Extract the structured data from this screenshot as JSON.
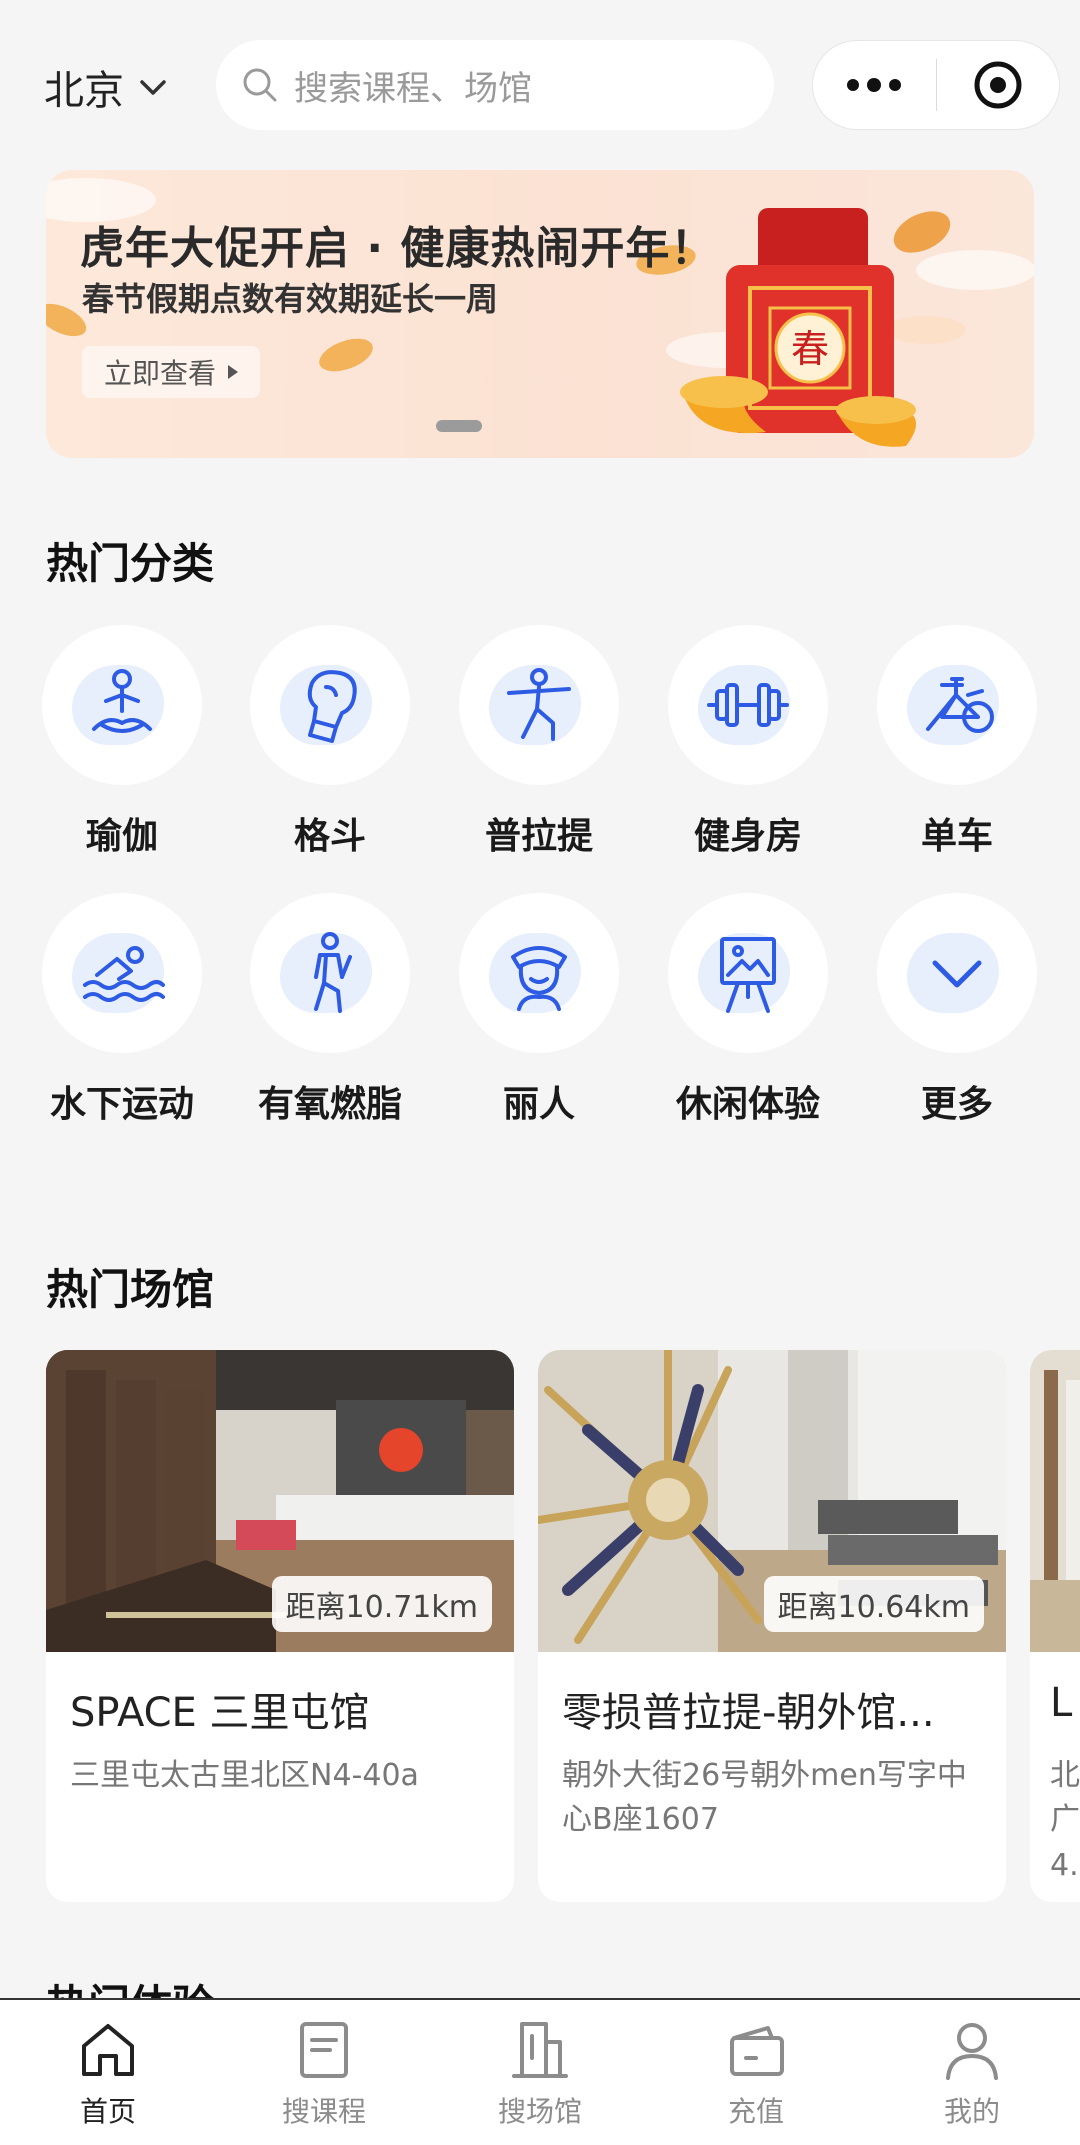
{
  "header": {
    "city": "北京",
    "search_placeholder": "搜索课程、场馆"
  },
  "banner": {
    "title": "虎年大促开启 · 健康热闹开年！",
    "subtitle": "春节假期点数有效期延长一周",
    "cta": "立即查看",
    "badge_char": "春"
  },
  "categories": {
    "title": "热门分类",
    "items": [
      {
        "label": "瑜伽",
        "icon": "meditation-icon"
      },
      {
        "label": "格斗",
        "icon": "boxing-glove-icon"
      },
      {
        "label": "普拉提",
        "icon": "stretch-pose-icon"
      },
      {
        "label": "健身房",
        "icon": "dumbbell-icon"
      },
      {
        "label": "单车",
        "icon": "bicycle-icon"
      },
      {
        "label": "水下运动",
        "icon": "swimming-icon"
      },
      {
        "label": "有氧燃脂",
        "icon": "running-icon"
      },
      {
        "label": "丽人",
        "icon": "beauty-icon"
      },
      {
        "label": "休闲体验",
        "icon": "easel-icon"
      },
      {
        "label": "更多",
        "icon": "chevron-down-icon"
      }
    ]
  },
  "venues": {
    "title": "热门场馆",
    "items": [
      {
        "name": "SPACE 三里屯馆",
        "address": "三里屯太古里北区N4-40a",
        "distance": "距离10.71km"
      },
      {
        "name": "零损普拉提-朝外馆...",
        "address": "朝外大街26号朝外men写字中心B座1607",
        "distance": "距离10.64km"
      },
      {
        "name": "L",
        "address": "北广",
        "distance": "",
        "extra": "4."
      }
    ]
  },
  "next_section": {
    "title": "热门体验"
  },
  "tabs": [
    {
      "label": "首页",
      "icon": "home-icon",
      "active": true
    },
    {
      "label": "搜课程",
      "icon": "course-icon",
      "active": false
    },
    {
      "label": "搜场馆",
      "icon": "building-icon",
      "active": false
    },
    {
      "label": "充值",
      "icon": "wallet-icon",
      "active": false
    },
    {
      "label": "我的",
      "icon": "user-icon",
      "active": false
    }
  ],
  "colors": {
    "accent_blue": "#2d5be3",
    "banner_bg": "#fbe2d3",
    "red_packet": "#e0312b"
  }
}
